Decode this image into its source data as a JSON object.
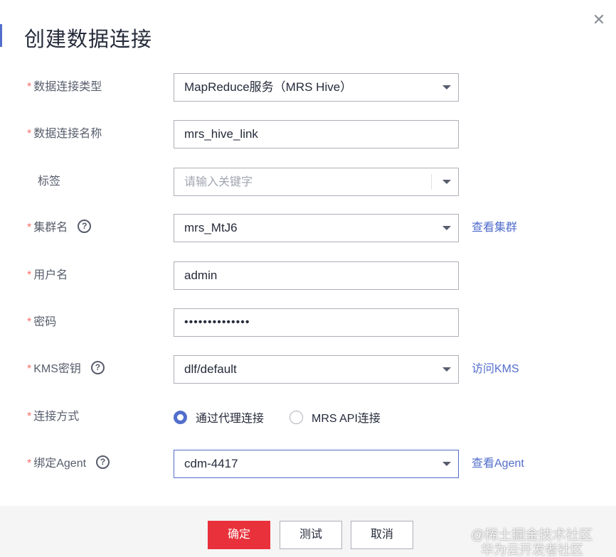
{
  "dialog": {
    "title": "创建数据连接",
    "close_icon": "close-icon"
  },
  "form": {
    "connection_type": {
      "required": "*",
      "label": "数据连接类型",
      "value": "MapReduce服务（MRS Hive）"
    },
    "connection_name": {
      "required": "*",
      "label": "数据连接名称",
      "value": "mrs_hive_link"
    },
    "tags": {
      "label": "标签",
      "placeholder": "请输入关键字"
    },
    "cluster": {
      "required": "*",
      "label": "集群名",
      "help": "?",
      "value": "mrs_MtJ6",
      "link": "查看集群"
    },
    "username": {
      "required": "*",
      "label": "用户名",
      "value": "admin"
    },
    "password": {
      "required": "*",
      "label": "密码",
      "value": "••••••••••••••"
    },
    "kms_key": {
      "required": "*",
      "label": "KMS密钥",
      "help": "?",
      "value": "dlf/default",
      "link": "访问KMS"
    },
    "connect_method": {
      "required": "*",
      "label": "连接方式",
      "options": [
        {
          "label": "通过代理连接",
          "checked": true
        },
        {
          "label": "MRS API连接",
          "checked": false
        }
      ]
    },
    "agent": {
      "required": "*",
      "label": "绑定Agent",
      "help": "?",
      "value": "cdm-4417",
      "link": "查看Agent"
    }
  },
  "footer": {
    "confirm": "确定",
    "test": "测试",
    "cancel": "取消"
  },
  "watermark": {
    "line1": "@稀土掘金技术社区",
    "line2": "华为云开发者社区"
  },
  "colors": {
    "primary_button": "#e8313a",
    "link": "#526ecc",
    "required": "#f66f6a",
    "radio_checked": "#526ecc"
  }
}
